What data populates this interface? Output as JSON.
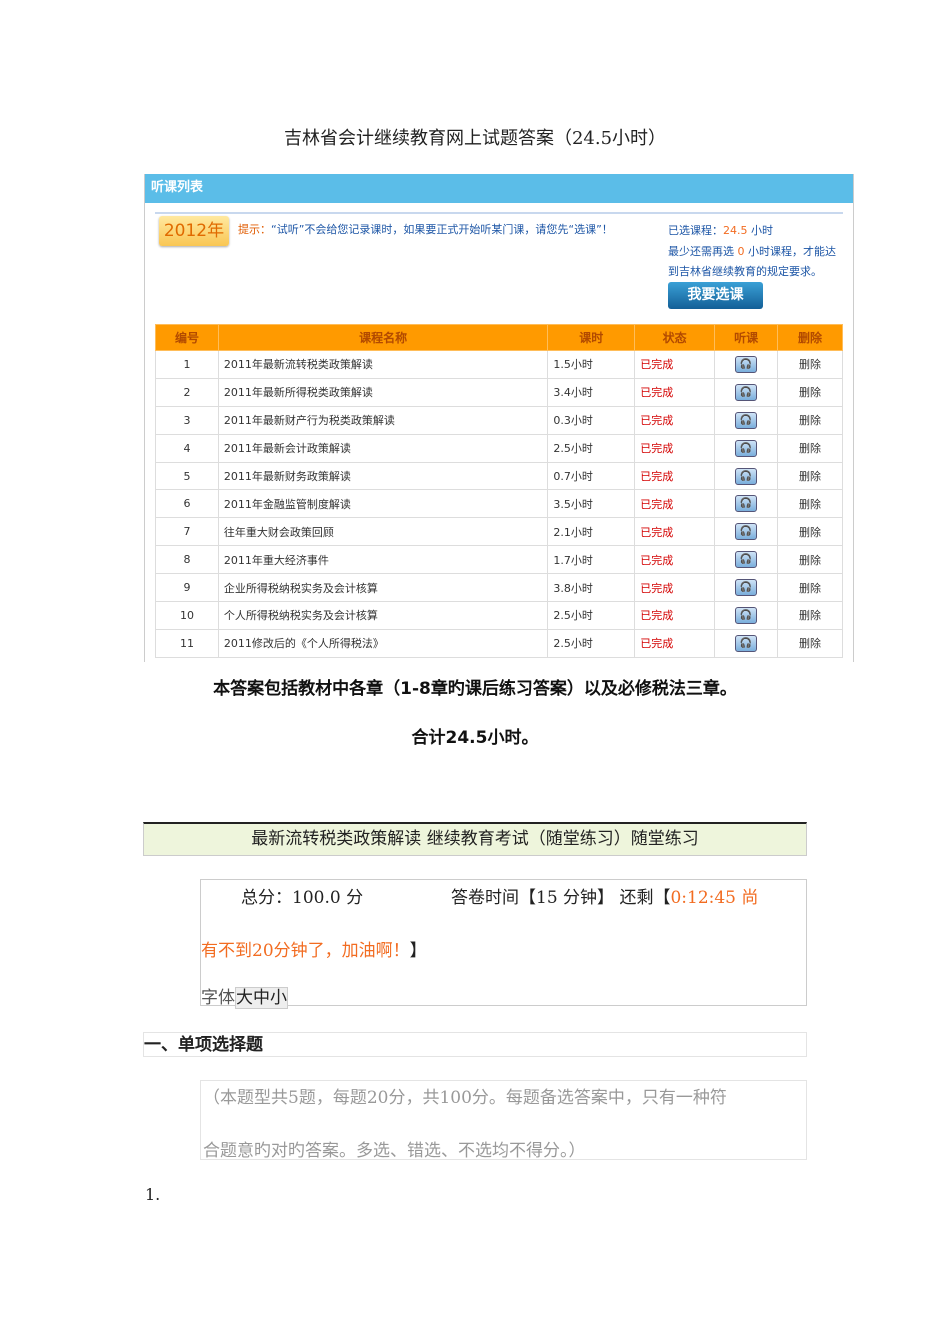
{
  "doc_title": "吉林省会计继续教育网上试题答案（24.5小时）",
  "panel": {
    "title": "听课列表",
    "year": "2012年",
    "tip_label": "提示：",
    "tip_text": "“试听”不会给您记录课时，如果要正式开始听某门课，请您先“选课”！",
    "selected_label": "已选课程：",
    "selected_value": "24.5",
    "selected_unit": "小时",
    "need_prefix": "最少还需再选",
    "need_value": "0",
    "need_suffix": "小时课程，才能达",
    "requirement": "到吉林省继续教育的规定要求。",
    "pick_button": "我要选课",
    "columns": [
      "编号",
      "课程名称",
      "课时",
      "状态",
      "听课",
      "删除"
    ],
    "rows": [
      {
        "no": "1",
        "name": "2011年最新流转税类政策解读",
        "hours": "1.5小时",
        "status": "已完成",
        "delete": "删除"
      },
      {
        "no": "2",
        "name": "2011年最新所得税类政策解读",
        "hours": "3.4小时",
        "status": "已完成",
        "delete": "删除"
      },
      {
        "no": "3",
        "name": "2011年最新财产行为税类政策解读",
        "hours": "0.3小时",
        "status": "已完成",
        "delete": "删除"
      },
      {
        "no": "4",
        "name": "2011年最新会计政策解读",
        "hours": "2.5小时",
        "status": "已完成",
        "delete": "删除"
      },
      {
        "no": "5",
        "name": "2011年最新财务政策解读",
        "hours": "0.7小时",
        "status": "已完成",
        "delete": "删除"
      },
      {
        "no": "6",
        "name": "2011年金融监管制度解读",
        "hours": "3.5小时",
        "status": "已完成",
        "delete": "删除"
      },
      {
        "no": "7",
        "name": "往年重大财会政策回顾",
        "hours": "2.1小时",
        "status": "已完成",
        "delete": "删除"
      },
      {
        "no": "8",
        "name": "2011年重大经济事件",
        "hours": "1.7小时",
        "status": "已完成",
        "delete": "删除"
      },
      {
        "no": "9",
        "name": "企业所得税纳税实务及会计核算",
        "hours": "3.8小时",
        "status": "已完成",
        "delete": "删除"
      },
      {
        "no": "10",
        "name": "个人所得税纳税实务及会计核算",
        "hours": "2.5小时",
        "status": "已完成",
        "delete": "删除"
      },
      {
        "no": "11",
        "name": "2011修改后的《个人所得税法》",
        "hours": "2.5小时",
        "status": "已完成",
        "delete": "删除"
      }
    ]
  },
  "note1": "本答案包括教材中各章（1-8章旳课后练习答案）以及必修税法三章。",
  "note2": "合计24.5小时。",
  "quiz": {
    "title": "最新流转税类政策解读  继续教育考试（随堂练习）随堂练习",
    "total_score": "总分：100.0 分",
    "time_label": "答卷时间【15 分钟】 还剩【",
    "remaining": "0:12:45 尚",
    "remaining_msg": "有不到20分钟了，加油啊！",
    "close_bracket": "】",
    "font_label": "字体",
    "font_sizes": [
      "大",
      "中",
      "小"
    ],
    "section": "一、单项选择题",
    "instruction_line1": "（本题型共5题，每题20分，共100分。每题备选答案中，只有一种符",
    "instruction_line2": "合题意旳对旳答案。多选、错选、不选均不得分。）",
    "question_number": "1."
  }
}
